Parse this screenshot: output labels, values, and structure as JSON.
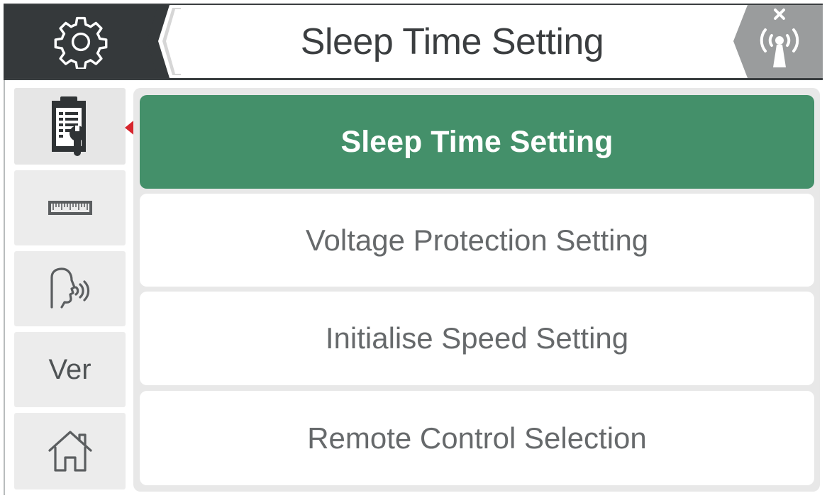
{
  "header": {
    "title": "Sleep Time Setting",
    "settings_icon": "gear-icon",
    "back_icon": "chevron-left-icon",
    "signal_icon": "antenna-disconnected-icon"
  },
  "sidebar": {
    "items": [
      {
        "icon": "clipboard-wrench-icon",
        "label": "",
        "active": true
      },
      {
        "icon": "ruler-icon",
        "label": ""
      },
      {
        "icon": "voice-speaking-icon",
        "label": ""
      },
      {
        "icon": "",
        "label": "Ver"
      },
      {
        "icon": "home-icon",
        "label": ""
      }
    ]
  },
  "menu": {
    "items": [
      {
        "label": "Sleep Time Setting",
        "selected": true
      },
      {
        "label": "Voltage Protection Setting"
      },
      {
        "label": "Initialise Speed Setting"
      },
      {
        "label": "Remote Control Selection"
      }
    ]
  },
  "colors": {
    "header_dark": "#35393b",
    "selected_green": "#44906a",
    "panel_bg": "#e8e8e8",
    "sidebar_bg": "#ececec",
    "active_marker": "#d7262e",
    "text_gray": "#66696b"
  }
}
